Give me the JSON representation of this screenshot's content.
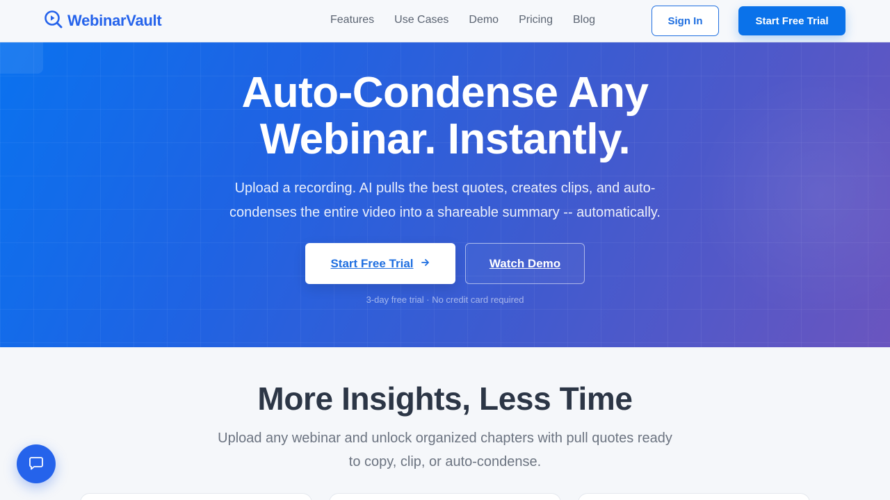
{
  "header": {
    "brand": "WebinarVault",
    "nav": [
      "Features",
      "Use Cases",
      "Demo",
      "Pricing",
      "Blog"
    ],
    "sign_in": "Sign In",
    "start_trial": "Start Free Trial"
  },
  "hero": {
    "title_line1": "Auto-Condense Any",
    "title_line2": "Webinar. Instantly.",
    "subtitle": "Upload a recording. AI pulls the best quotes, creates clips, and auto-condenses the entire video into a shareable summary -- automatically.",
    "cta_primary": "Start Free Trial",
    "cta_secondary": "Watch Demo",
    "note": "3-day free trial · No credit card required"
  },
  "insights": {
    "title": "More Insights, Less Time",
    "subtitle": "Upload any webinar and unlock organized chapters with pull quotes ready to copy, clip, or auto-condense."
  },
  "icons": {
    "logo": "play-search-icon",
    "arrow": "arrow-right-icon",
    "chat": "chat-icon"
  },
  "colors": {
    "brand": "#2563eb",
    "cta": "#0a72ea",
    "hero_start": "#0a72ef",
    "hero_end": "#6a55bf"
  }
}
